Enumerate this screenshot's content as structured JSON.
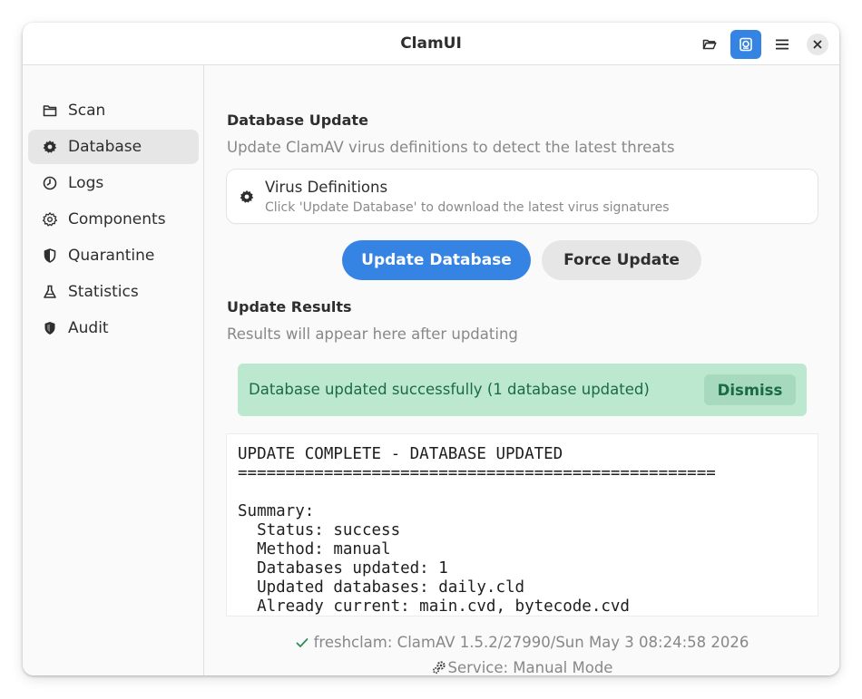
{
  "window": {
    "title": "ClamUI"
  },
  "sidebar": {
    "items": [
      {
        "label": "Scan",
        "icon": "folder-icon"
      },
      {
        "label": "Database",
        "icon": "gear-icon",
        "selected": true
      },
      {
        "label": "Logs",
        "icon": "clock-icon"
      },
      {
        "label": "Components",
        "icon": "gear-icon"
      },
      {
        "label": "Quarantine",
        "icon": "shield-icon"
      },
      {
        "label": "Statistics",
        "icon": "flask-icon"
      },
      {
        "label": "Audit",
        "icon": "shield-icon"
      }
    ]
  },
  "database_update": {
    "title": "Database Update",
    "subtitle": "Update ClamAV virus definitions to detect the latest threats"
  },
  "virus_definitions": {
    "title": "Virus Definitions",
    "subtitle": "Click 'Update Database' to download the latest virus signatures"
  },
  "actions": {
    "update_label": "Update Database",
    "force_label": "Force Update"
  },
  "results": {
    "title": "Update Results",
    "subtitle": "Results will appear here after updating"
  },
  "banner": {
    "message": "Database updated successfully (1 database updated)",
    "dismiss_label": "Dismiss"
  },
  "output": {
    "text": "UPDATE COMPLETE - DATABASE UPDATED\n==================================================\n\nSummary:\n  Status: success\n  Method: manual\n  Databases updated: 1\n  Updated databases: daily.cld\n  Already current: main.cvd, bytecode.cvd"
  },
  "footer": {
    "freshclam": "freshclam: ClamAV 1.5.2/27990/Sun May  3 08:24:58 2026",
    "service": "Service: Manual Mode"
  },
  "colors": {
    "accent": "#3584e4",
    "success_bg": "#bce8d0",
    "success_text": "#1a6b45",
    "success_check": "#2e8b57"
  }
}
